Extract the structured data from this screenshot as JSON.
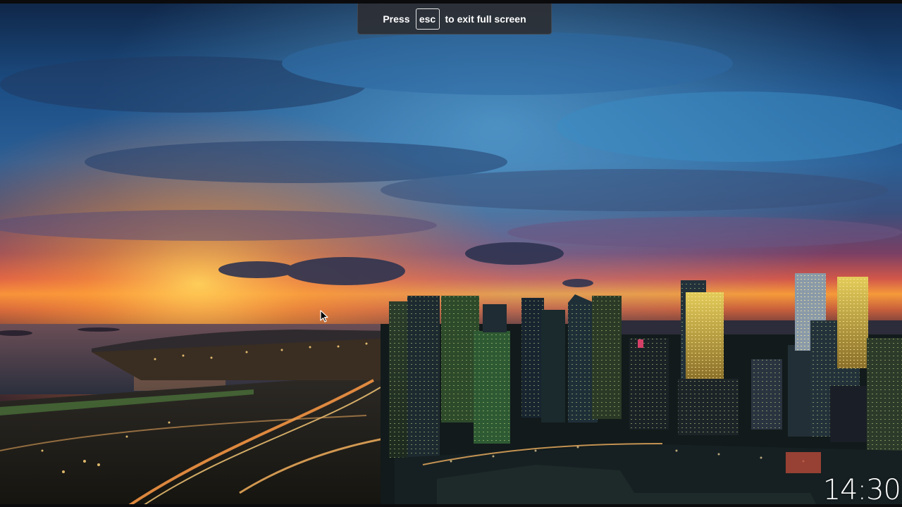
{
  "fullscreen_notice": {
    "prefix": "Press",
    "key": "esc",
    "suffix": "to exit full screen"
  },
  "clock": {
    "time": "14:30"
  },
  "wallpaper": {
    "description_icon": "city-skyline-sunset",
    "colors": {
      "sky_top": "#1c3a63",
      "sky_blue": "#3f86c4",
      "sunset_orange": "#f2a03a",
      "sunset_red": "#d44a3a",
      "city_dark": "#0d1414"
    }
  },
  "cursor": {
    "icon": "arrow-cursor-icon"
  }
}
